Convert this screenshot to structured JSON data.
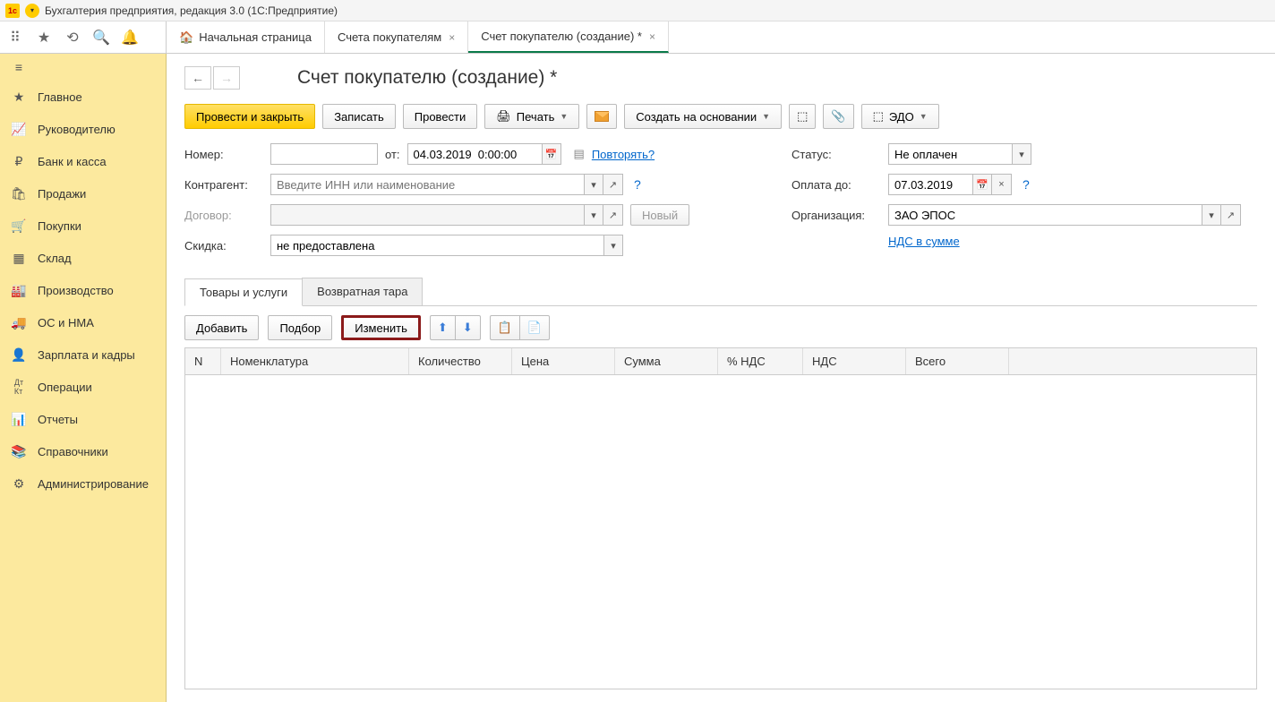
{
  "titlebar": {
    "text": "Бухгалтерия предприятия, редакция 3.0   (1С:Предприятие)"
  },
  "tabs": {
    "home": "Начальная страница",
    "t1": "Счета покупателям",
    "t2": "Счет покупателю (создание) *"
  },
  "sidebar": {
    "items": [
      {
        "icon": "≡",
        "label": "Главное"
      },
      {
        "icon": "📈",
        "label": "Руководителю"
      },
      {
        "icon": "₽",
        "label": "Банк и касса"
      },
      {
        "icon": "🛍",
        "label": "Продажи"
      },
      {
        "icon": "🛒",
        "label": "Покупки"
      },
      {
        "icon": "▦",
        "label": "Склад"
      },
      {
        "icon": "🏭",
        "label": "Производство"
      },
      {
        "icon": "🚚",
        "label": "ОС и НМА"
      },
      {
        "icon": "👤",
        "label": "Зарплата и кадры"
      },
      {
        "icon": "ᵈᴷ",
        "label": "Операции"
      },
      {
        "icon": "📊",
        "label": "Отчеты"
      },
      {
        "icon": "📚",
        "label": "Справочники"
      },
      {
        "icon": "⚙",
        "label": "Администрирование"
      }
    ]
  },
  "page": {
    "title": "Счет покупателю (создание) *"
  },
  "actions": {
    "post_close": "Провести и закрыть",
    "save": "Записать",
    "post": "Провести",
    "print": "Печать",
    "create_based": "Создать на основании",
    "edo": "ЭДО"
  },
  "form": {
    "number_label": "Номер:",
    "number_value": "",
    "from_label": "от:",
    "date_value": "04.03.2019  0:00:00",
    "repeat_link": "Повторять?",
    "contractor_label": "Контрагент:",
    "contractor_placeholder": "Введите ИНН или наименование",
    "contract_label": "Договор:",
    "contract_new": "Новый",
    "discount_label": "Скидка:",
    "discount_value": "не предоставлена",
    "status_label": "Статус:",
    "status_value": "Не оплачен",
    "payuntil_label": "Оплата до:",
    "payuntil_value": "07.03.2019",
    "org_label": "Организация:",
    "org_value": "ЗАО ЭПОС",
    "vat_link": "НДС в сумме"
  },
  "subtabs": {
    "t1": "Товары и услуги",
    "t2": "Возвратная тара"
  },
  "table_actions": {
    "add": "Добавить",
    "select": "Подбор",
    "change": "Изменить"
  },
  "table_headers": {
    "n": "N",
    "nomenclature": "Номенклатура",
    "qty": "Количество",
    "price": "Цена",
    "sum": "Сумма",
    "vat_pct": "% НДС",
    "vat": "НДС",
    "total": "Всего"
  }
}
